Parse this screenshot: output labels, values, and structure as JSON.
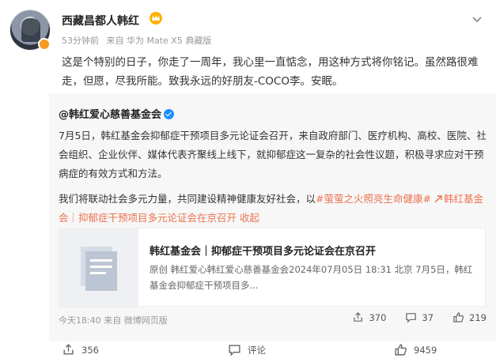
{
  "post": {
    "username": "西藏昌都人韩红",
    "time": "53分钟前",
    "source": "来自 华为 Mate X5 典藏版",
    "text": "这是个特别的日子，你走了一周年，我心里一直惦念，用这种方式将你铭记。虽然路很难走，但愿，尽我所能。致我永远的好朋友-COCO李。安眠。"
  },
  "repost": {
    "author": "@韩红爱心慈善基金会",
    "paragraph1": "7月5日，韩红基金会抑郁症干预项目多元论证会召开，来自政府部门、医疗机构、高校、医院、社会组织、企业伙伴、媒体代表齐聚线上线下，就抑郁症这一复杂的社会性议题，积极寻求应对干预病症的有效方式和方法。",
    "paragraph2_prefix": "我们将联动社会多元力量，共同建设精神健康友好社会，以",
    "hashtag": "#萤萤之火照亮生命健康#",
    "link_text": "韩红基金会｜抑郁症干预项目多元论证会在京召开",
    "collapse": "收起",
    "card": {
      "title": "韩红基金会｜抑郁症干预项目多元论证会在京召开",
      "desc": "原创 韩红爱心韩红爱心慈善基金会2024年07月05日 18:31 北京 7月5日，韩红基金会抑郁症干预项目多..."
    },
    "time": "今天18:40 来自 微博网页版",
    "reposts": "370",
    "comments": "37",
    "likes": "219"
  },
  "actions": {
    "repost_count": "356",
    "comment_label": "评论",
    "like_count": "9459"
  },
  "colors": {
    "accent": "#eb7350",
    "verify_blue": "#1e90ff",
    "verify_orange": "#f59b1f"
  }
}
